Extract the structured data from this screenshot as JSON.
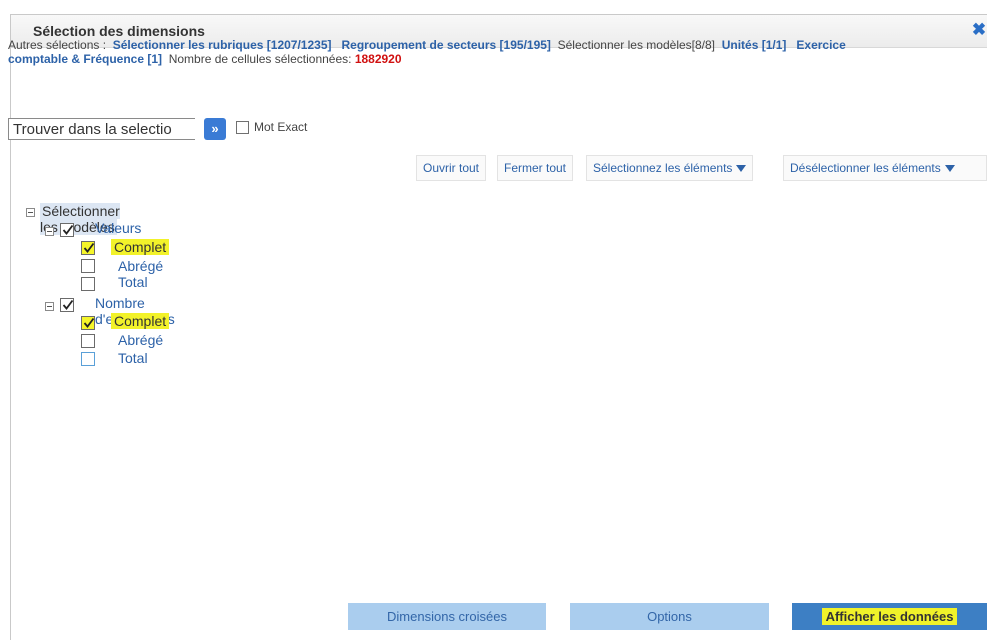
{
  "dialog": {
    "title": "Sélection des dimensions",
    "close_icon": "close-icon"
  },
  "other_selections": {
    "prefix": "Autres sélections :",
    "items": [
      {
        "text": "Sélectionner les rubriques [1207/1235]",
        "link": true
      },
      {
        "text": "Regroupement de secteurs [195/195]",
        "link": true
      },
      {
        "text": "Sélectionner les modèles[8/8]",
        "link": false
      },
      {
        "text": "Unités [1/1]",
        "link": true
      },
      {
        "text": "Exercice comptable & Fréquence [1]",
        "link": true
      }
    ],
    "cells_label": "Nombre de cellules sélectionnées:",
    "cells_value": "1882920"
  },
  "search": {
    "value": "Trouver dans la selectio",
    "go_label": "»",
    "exact_label": "Mot Exact"
  },
  "toolbar": {
    "open_all": "Ouvrir tout",
    "close_all": "Fermer tout",
    "select_items": "Sélectionnez les éléments",
    "deselect_items": "Désélectionner les éléments"
  },
  "tree": {
    "root": "Sélectionner les modèles",
    "groups": [
      {
        "label": "Valeurs",
        "checked": true,
        "children": [
          {
            "label": "Complet",
            "checked": true
          },
          {
            "label": "Abrégé",
            "checked": false
          },
          {
            "label": "Total",
            "checked": false
          }
        ]
      },
      {
        "label": "Nombre d'entreprises",
        "checked": true,
        "children": [
          {
            "label": "Complet",
            "checked": true
          },
          {
            "label": "Abrégé",
            "checked": false
          },
          {
            "label": "Total",
            "checked": false
          }
        ]
      }
    ]
  },
  "buttons": {
    "cross_dims": "Dimensions croisées",
    "options": "Options",
    "show_data": "Afficher les données"
  },
  "colors": {
    "accent": "#2d62a8",
    "highlight": "#f5f52a",
    "primary_button": "#3d7fc4",
    "secondary_button": "#aacdee",
    "cell_count": "#d01010"
  }
}
